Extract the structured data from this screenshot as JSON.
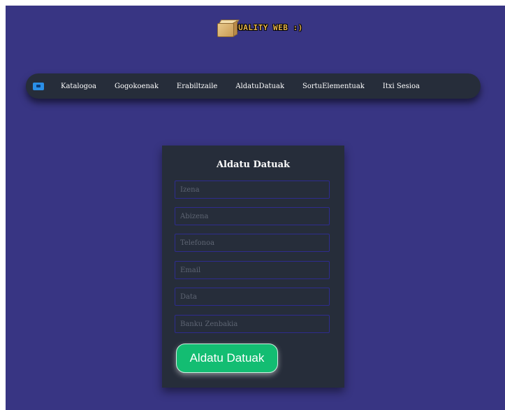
{
  "header": {
    "logo_text": "QUALITY WEB :)",
    "logo_icon": "cardboard-box-icon"
  },
  "navbar": {
    "home_icon": "home-logo-icon",
    "items": [
      {
        "label": "Katalogoa"
      },
      {
        "label": "Gogokoenak"
      },
      {
        "label": "Erabiltzaile"
      },
      {
        "label": "AldatuDatuak"
      },
      {
        "label": "SortuElementuak"
      },
      {
        "label": "Itxi Sesioa"
      }
    ]
  },
  "form": {
    "title": "Aldatu Datuak",
    "fields": [
      {
        "placeholder": "Izena",
        "value": ""
      },
      {
        "placeholder": "Abizena",
        "value": ""
      },
      {
        "placeholder": "Telefonoa",
        "value": ""
      },
      {
        "placeholder": "Email",
        "value": ""
      },
      {
        "placeholder": "Data",
        "value": ""
      },
      {
        "placeholder": "Banku Zenbakia",
        "value": ""
      }
    ],
    "submit_label": "Aldatu Datuak"
  },
  "colors": {
    "background": "#383583",
    "navbar": "#262d3a",
    "card": "#262d3a",
    "button": "#13bd72",
    "field_border": "#2e2c8e"
  }
}
